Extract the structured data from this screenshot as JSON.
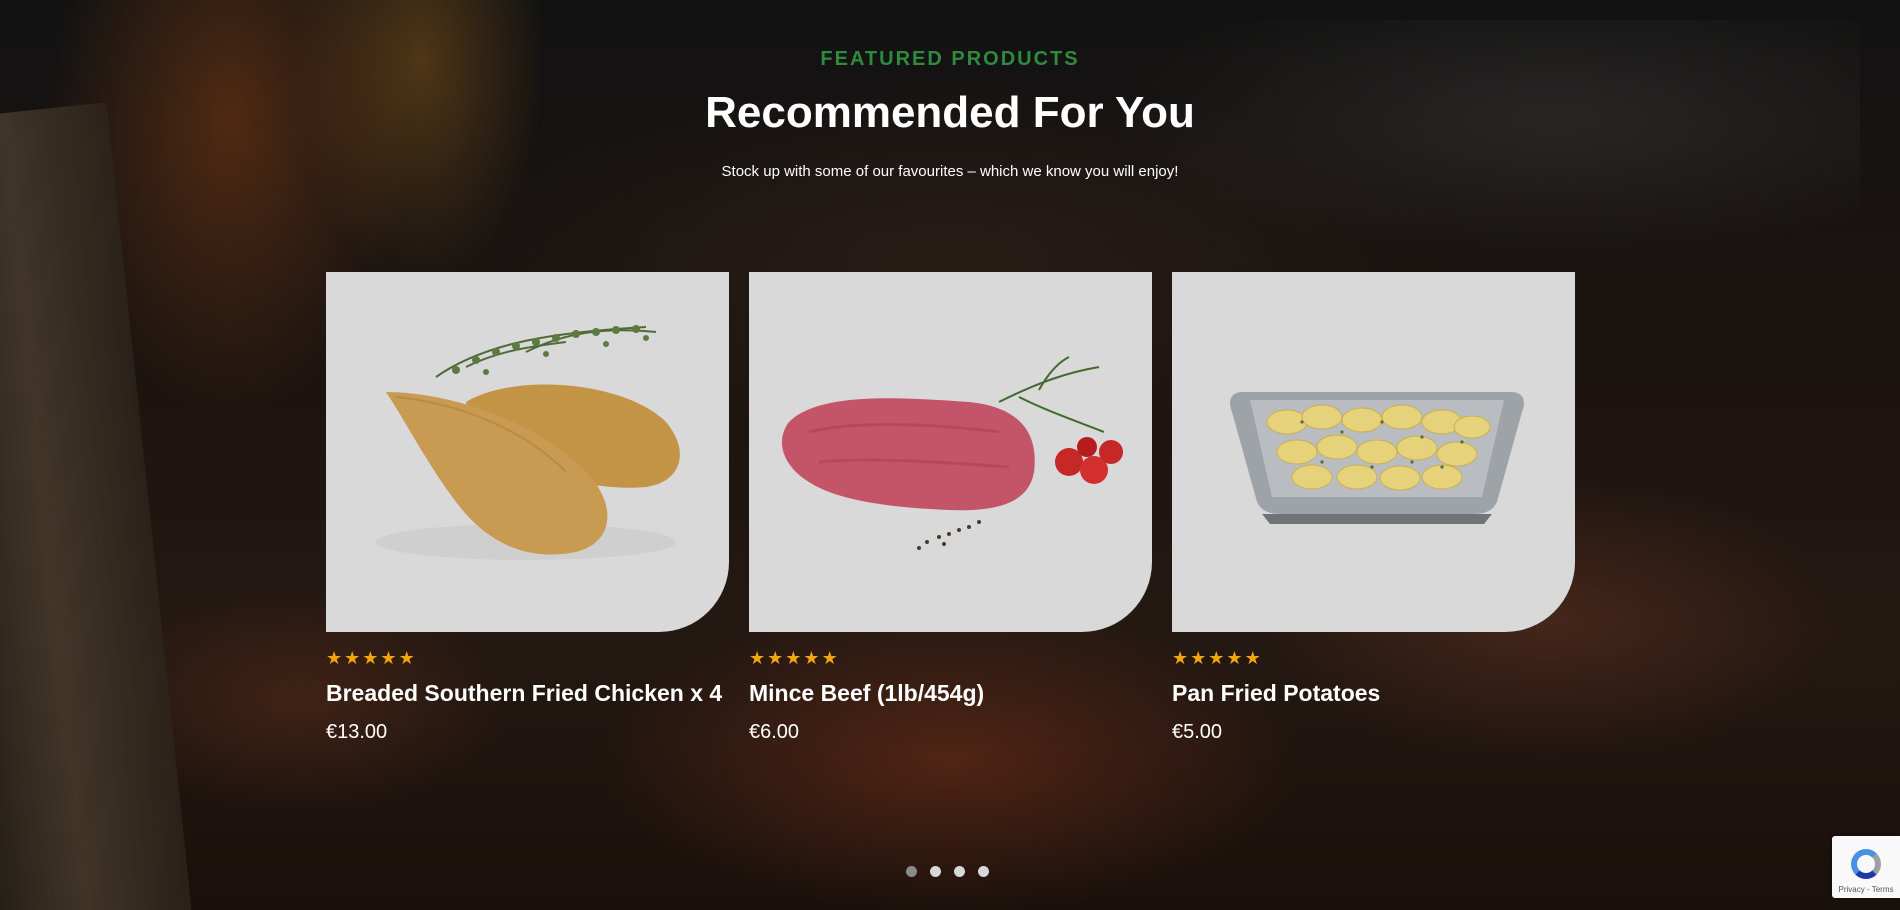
{
  "header": {
    "eyebrow": "FEATURED PRODUCTS",
    "title": "Recommended For You",
    "subtitle": "Stock up with some of our favourites – which we know you will enjoy!"
  },
  "products": [
    {
      "name": "Breaded Southern Fried Chicken x 4",
      "price": "€13.00",
      "rating": 5,
      "image_icon": "fried-chicken-image"
    },
    {
      "name": "Mince Beef (1lb/454g)",
      "price": "€6.00",
      "rating": 5,
      "image_icon": "mince-beef-image"
    },
    {
      "name": "Pan Fried Potatoes",
      "price": "€5.00",
      "rating": 5,
      "image_icon": "potatoes-tray-image"
    }
  ],
  "carousel": {
    "page_count": 4,
    "active_index": 0
  },
  "recaptcha": {
    "links": "Privacy - Terms"
  },
  "colors": {
    "accent_green": "#2e8b3e",
    "star": "#f2a60d",
    "card_bg": "#d9d9d9"
  }
}
